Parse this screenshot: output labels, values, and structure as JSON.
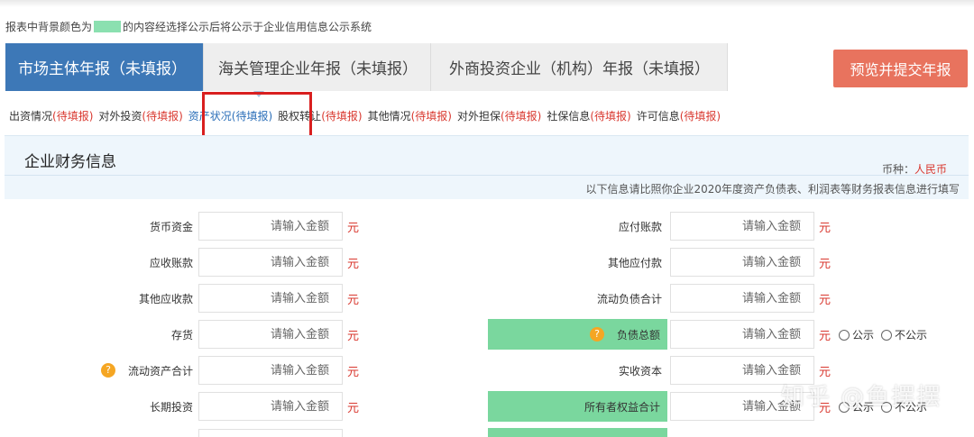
{
  "notice": {
    "before": "报表中背景颜色为",
    "after": "的内容经选择公示后将公示于企业信用信息公示系统",
    "swatch_color": "#8be0b0"
  },
  "tabs": [
    {
      "label": "市场主体年报（未填报）",
      "active": true
    },
    {
      "label": "海关管理企业年报（未填报）",
      "active": false
    },
    {
      "label": "外商投资企业（机构）年报（未填报）",
      "active": false
    }
  ],
  "submit_label": "预览并提交年报",
  "subnav": [
    {
      "name": "出资情况",
      "status": "(待填报)"
    },
    {
      "name": "对外投资",
      "status": "(待填报)"
    },
    {
      "name": "资产状况",
      "status": "(待填报)",
      "current": true
    },
    {
      "name": "股权转让",
      "status": "(待填报)"
    },
    {
      "name": "其他情况",
      "status": "(待填报)"
    },
    {
      "name": "对外担保",
      "status": "(待填报)"
    },
    {
      "name": "社保信息",
      "status": "(待填报)"
    },
    {
      "name": "许可信息",
      "status": "(待填报)"
    }
  ],
  "section": {
    "title": "企业财务信息",
    "currency_label": "币种：",
    "currency_value": "人民币",
    "note": "以下信息请比照你企业2020年度资产负债表、利润表等财务报表信息进行填写"
  },
  "form": {
    "placeholder": "请输入金额",
    "unit": "元",
    "disclose_yes": "公示",
    "disclose_no": "不公示",
    "rows": [
      {
        "left": {
          "label": "货币资金"
        },
        "right": {
          "label": "应付账款"
        }
      },
      {
        "left": {
          "label": "应收账款"
        },
        "right": {
          "label": "其他应付款"
        }
      },
      {
        "left": {
          "label": "其他应收款"
        },
        "right": {
          "label": "流动负债合计"
        }
      },
      {
        "left": {
          "label": "存货"
        },
        "right": {
          "label": "负债总额",
          "green": true,
          "help": true,
          "disclose": true
        }
      },
      {
        "left": {
          "label": "流动资产合计",
          "help": true
        },
        "right": {
          "label": "实收资本"
        }
      },
      {
        "left": {
          "label": "长期投资"
        },
        "right": {
          "label": "所有者权益合计",
          "green": true,
          "disclose": true
        }
      }
    ]
  },
  "watermark": "知乎 @鱼摆摆"
}
